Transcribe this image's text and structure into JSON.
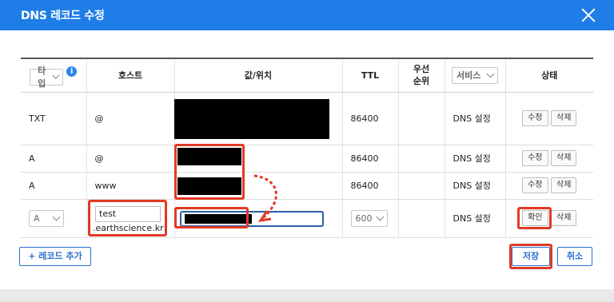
{
  "dialog": {
    "title": "DNS 레코드 수정"
  },
  "header": {
    "type_select": "타입",
    "info_icon": "i",
    "host": "호스트",
    "value": "값/위치",
    "ttl": "TTL",
    "priority": "우선\n순위",
    "service_select": "서비스",
    "status": "상태"
  },
  "rows": [
    {
      "type": "TXT",
      "host": "@",
      "ttl": "86400",
      "service": "DNS 설정",
      "edit": "수정",
      "delete": "삭제"
    },
    {
      "type": "A",
      "host": "@",
      "ttl": "86400",
      "service": "DNS 설정",
      "edit": "수정",
      "delete": "삭제"
    },
    {
      "type": "A",
      "host": "www",
      "ttl": "86400",
      "service": "DNS 설정",
      "edit": "수정",
      "delete": "삭제"
    }
  ],
  "edit_row": {
    "type": "A",
    "host_input": "test",
    "host_suffix": ".earthscience.kr",
    "ttl": "600",
    "service": "DNS 설정",
    "confirm": "확인",
    "delete": "삭제"
  },
  "footer": {
    "add": "+ 레코드 추가",
    "save": "저장",
    "cancel": "취소"
  },
  "colors": {
    "accent": "#1e7de6",
    "annotation": "#e03a25"
  }
}
